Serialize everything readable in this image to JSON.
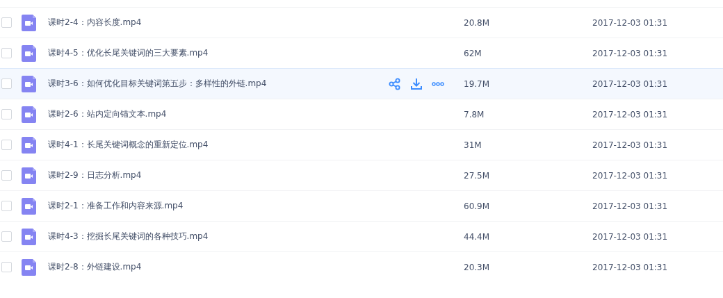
{
  "files": [
    {
      "name": "课时2-4：内容长度.mp4",
      "size": "20.8M",
      "date": "2017-12-03 01:31",
      "checked": false,
      "hovered": false
    },
    {
      "name": "课时4-5：优化长尾关键词的三大要素.mp4",
      "size": "62M",
      "date": "2017-12-03 01:31",
      "checked": false,
      "hovered": false
    },
    {
      "name": "课时3-6：如何优化目标关键词第五步：多样性的外链.mp4",
      "size": "19.7M",
      "date": "2017-12-03 01:31",
      "checked": false,
      "hovered": true
    },
    {
      "name": "课时2-6：站内定向锚文本.mp4",
      "size": "7.8M",
      "date": "2017-12-03 01:31",
      "checked": false,
      "hovered": false
    },
    {
      "name": "课时4-1：长尾关键词概念的重新定位.mp4",
      "size": "31M",
      "date": "2017-12-03 01:31",
      "checked": false,
      "hovered": false
    },
    {
      "name": "课时2-9：日志分析.mp4",
      "size": "27.5M",
      "date": "2017-12-03 01:31",
      "checked": false,
      "hovered": false
    },
    {
      "name": "课时2-1：准备工作和内容来源.mp4",
      "size": "60.9M",
      "date": "2017-12-03 01:31",
      "checked": false,
      "hovered": false
    },
    {
      "name": "课时4-3：挖掘长尾关键词的各种技巧.mp4",
      "size": "44.4M",
      "date": "2017-12-03 01:31",
      "checked": false,
      "hovered": false
    },
    {
      "name": "课时2-8：外链建设.mp4",
      "size": "20.3M",
      "date": "2017-12-03 01:31",
      "checked": false,
      "hovered": false
    }
  ]
}
